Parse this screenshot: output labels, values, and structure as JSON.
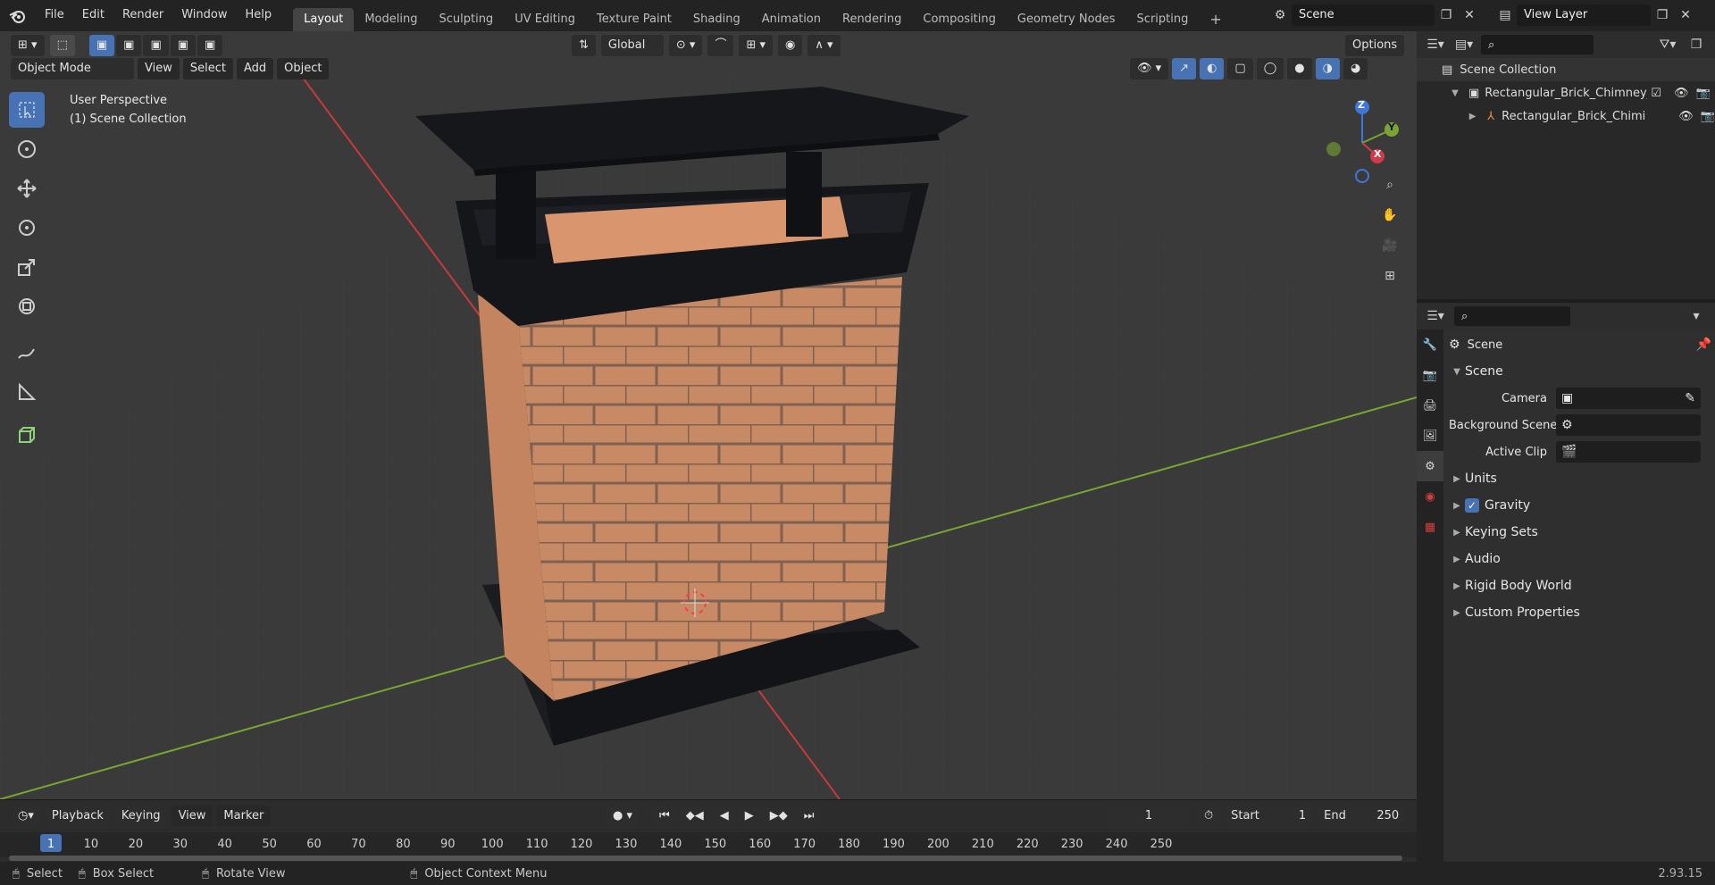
{
  "top_menu": [
    "File",
    "Edit",
    "Render",
    "Window",
    "Help"
  ],
  "workspace_tabs": [
    "Layout",
    "Modeling",
    "Sculpting",
    "UV Editing",
    "Texture Paint",
    "Shading",
    "Animation",
    "Rendering",
    "Compositing",
    "Geometry Nodes",
    "Scripting"
  ],
  "active_workspace": "Layout",
  "scene_field": "Scene",
  "view_layer_field": "View Layer",
  "viewport": {
    "mode": "Object Mode",
    "menus": [
      "View",
      "Select",
      "Add",
      "Object"
    ],
    "transform_orientation": "Global",
    "options_label": "Options",
    "overlay_line1": "User Perspective",
    "overlay_line2": "(1) Scene Collection",
    "gizmo_labels": {
      "z": "Z",
      "y": "Y",
      "x": "X"
    }
  },
  "outliner": {
    "root": "Scene Collection",
    "collection": "Rectangular_Brick_Chimney_",
    "object": "Rectangular_Brick_Chimi"
  },
  "properties": {
    "header": "Scene",
    "panel_title": "Scene",
    "fields": [
      {
        "label": "Camera"
      },
      {
        "label": "Background Scene"
      },
      {
        "label": "Active Clip"
      }
    ],
    "sections": [
      "Units",
      "Gravity",
      "Keying Sets",
      "Audio",
      "Rigid Body World",
      "Custom Properties"
    ],
    "gravity_checked": true
  },
  "timeline": {
    "menus": [
      "Playback",
      "Keying",
      "View",
      "Marker"
    ],
    "current_frame": "1",
    "start_label": "Start",
    "start_value": "1",
    "end_label": "End",
    "end_value": "250",
    "ticks": [
      "1",
      "10",
      "20",
      "30",
      "40",
      "50",
      "60",
      "70",
      "80",
      "90",
      "100",
      "110",
      "120",
      "130",
      "140",
      "150",
      "160",
      "170",
      "180",
      "190",
      "200",
      "210",
      "220",
      "230",
      "240",
      "250"
    ]
  },
  "statusbar": {
    "select": "Select",
    "box_select": "Box Select",
    "rotate_view": "Rotate View",
    "context_menu": "Object Context Menu",
    "version": "2.93.15"
  },
  "colors": {
    "accent": "#4772b3",
    "x_axis": "#c83a3a",
    "y_axis": "#7aa532",
    "brick": "#d9956e"
  }
}
